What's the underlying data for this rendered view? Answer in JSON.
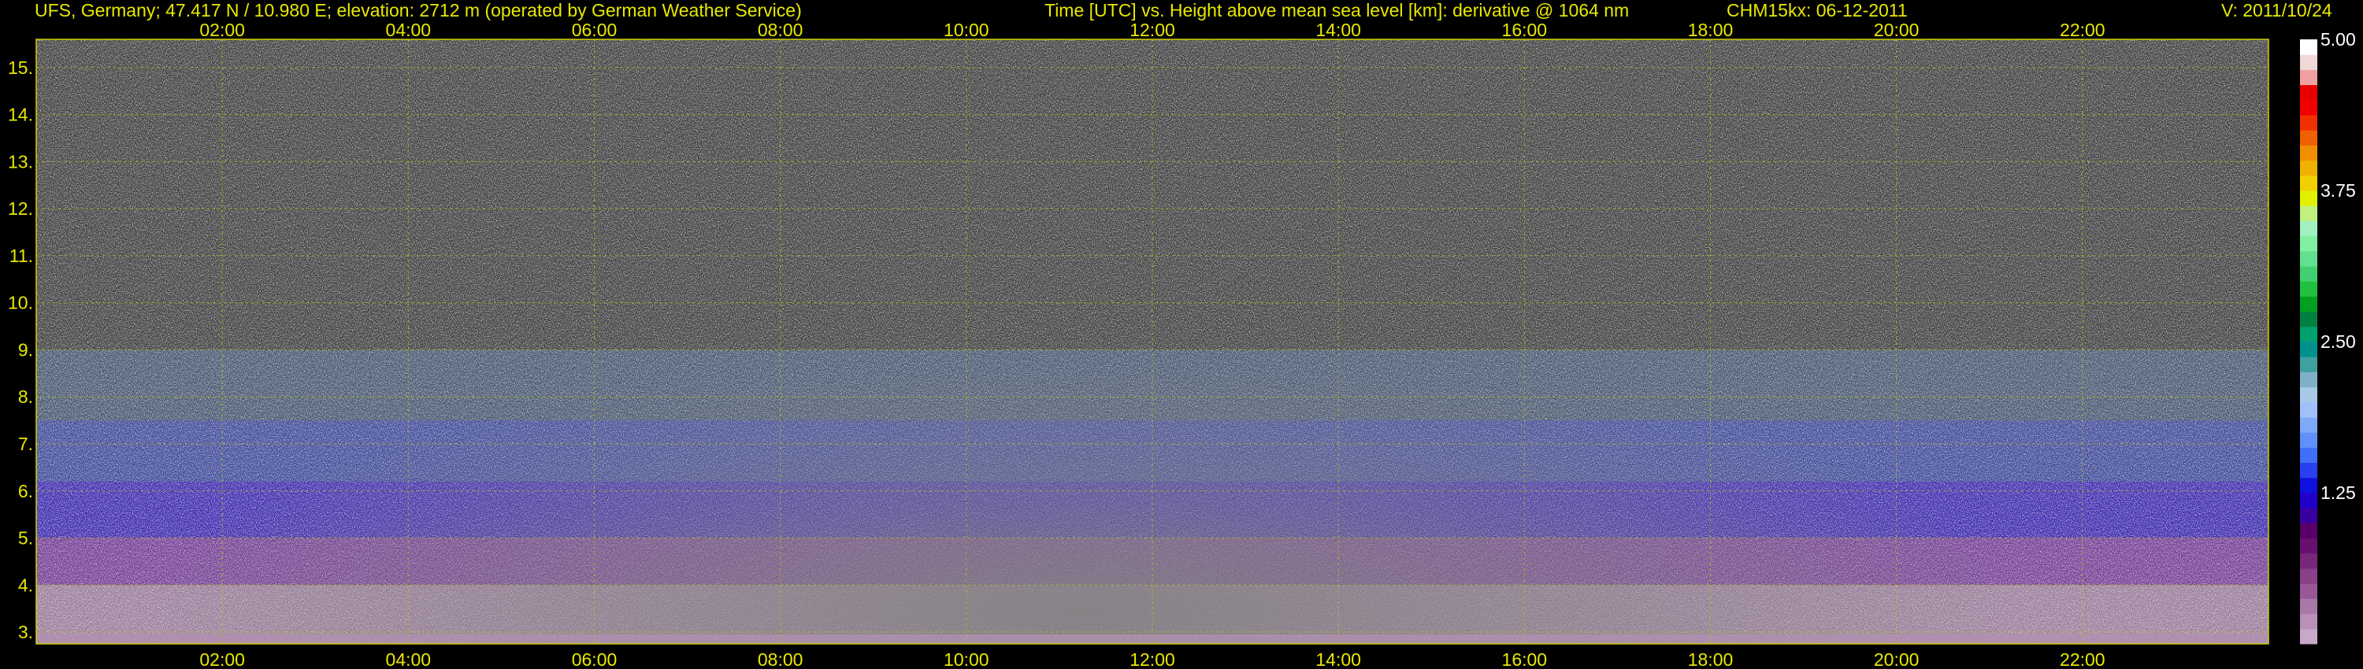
{
  "header": {
    "station": "UFS, Germany; 47.417 N / 10.980 E; elevation: 2712 m  (operated by German Weather Service)",
    "title": "Time [UTC] vs. Height above mean sea level [km]: derivative @ 1064 nm",
    "instrument": "CHM15kx: 06-12-2011",
    "version": "V: 2011/10/24"
  },
  "chart_data": {
    "type": "heatmap",
    "title": "Time [UTC] vs. Height above mean sea level [km]: derivative @ 1064 nm",
    "xlabel": "Time [UTC]",
    "ylabel": "Height above mean sea level [km]",
    "xlim": [
      0,
      24
    ],
    "ylim": [
      2.75,
      15.6
    ],
    "x_ticks": [
      "02:00",
      "04:00",
      "06:00",
      "08:00",
      "10:00",
      "12:00",
      "14:00",
      "16:00",
      "18:00",
      "20:00",
      "22:00"
    ],
    "x_tick_values": [
      2,
      4,
      6,
      8,
      10,
      12,
      14,
      16,
      18,
      20,
      22
    ],
    "y_ticks": [
      "3.",
      "4.",
      "5.",
      "6.",
      "7.",
      "8.",
      "9.",
      "10.",
      "11.",
      "12.",
      "13.",
      "14.",
      "15."
    ],
    "y_tick_values": [
      3,
      4,
      5,
      6,
      7,
      8,
      9,
      10,
      11,
      12,
      13,
      14,
      15
    ],
    "grid": true,
    "colorbar": {
      "range": [
        0,
        5
      ],
      "ticks": [
        "1.25",
        "2.50",
        "3.75",
        "5.00"
      ],
      "tick_values": [
        1.25,
        2.5,
        3.75,
        5.0
      ],
      "colors": [
        "#c8a8c8",
        "#b890b8",
        "#a878a8",
        "#985898",
        "#884088",
        "#782878",
        "#681070",
        "#580068",
        "#3800a0",
        "#2000c8",
        "#1010e0",
        "#2840f0",
        "#4070f8",
        "#6090f8",
        "#80a8f8",
        "#a0c0f8",
        "#a8c8e8",
        "#80b0c8",
        "#40a0a0",
        "#009090",
        "#00a070",
        "#008040",
        "#00a020",
        "#20c040",
        "#40d070",
        "#60e090",
        "#80f0a0",
        "#a0f0c0",
        "#c0f080",
        "#e0f000",
        "#f0d000",
        "#f0b000",
        "#f09000",
        "#f06000",
        "#f03000",
        "#f00000",
        "#e80000",
        "#f0a0a0",
        "#f0d8d8",
        "#ffffff"
      ]
    }
  }
}
